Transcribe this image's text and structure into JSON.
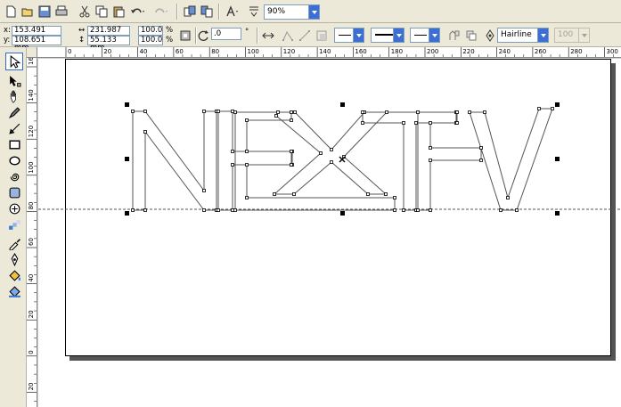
{
  "toolbar": {
    "zoom": "90%",
    "new_icon": "new-document-icon",
    "open_icon": "open-icon",
    "save_icon": "save-icon",
    "print_icon": "print-icon",
    "cut_icon": "cut-icon",
    "copy_icon": "copy-icon",
    "paste_icon": "paste-icon",
    "undo_icon": "undo-icon",
    "redo_icon": "redo-icon",
    "import_icon": "import-icon",
    "export_icon": "export-icon",
    "launcher_icon": "application-launcher-icon",
    "snap_icon": "snap-icon"
  },
  "property_bar": {
    "x_label": "x:",
    "x_value": "153.491 mm",
    "y_label": "y:",
    "y_value": "108.651 mm",
    "width_value": "231.987 mm",
    "height_value": "55.133 mm",
    "scale_x": "100.0",
    "scale_y": "100.0",
    "percent": "%",
    "rotation": ".0",
    "degree": "°",
    "outline_width": "Hairline",
    "opacity": "100"
  },
  "ruler_top": {
    "ticks": [
      "0",
      "20",
      "40",
      "60",
      "80",
      "100",
      "120",
      "140",
      "160",
      "180",
      "200",
      "220",
      "240",
      "260",
      "280",
      "300"
    ]
  },
  "ruler_left": {
    "ticks": [
      "160",
      "140",
      "120",
      "100",
      "80",
      "60",
      "40",
      "20",
      "0",
      "20"
    ]
  },
  "toolbox": {
    "tools": [
      "pick-tool-icon",
      "shape-tool-icon",
      "pan-tool-icon",
      "freehand-tool-icon",
      "smart-fill-icon",
      "rectangle-tool-icon",
      "ellipse-tool-icon",
      "spiral-tool-icon",
      "basic-shapes-icon",
      "text-tool-icon",
      "interactive-blend-icon",
      "eyedropper-icon",
      "outline-pen-icon",
      "fill-tool-icon",
      "interactive-fill-icon"
    ]
  },
  "colors": {
    "selection": "#000000",
    "outline": "#555555",
    "guideline": "#555555"
  }
}
